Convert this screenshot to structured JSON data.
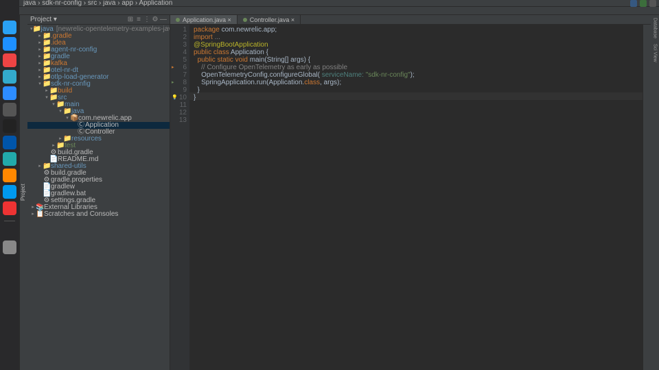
{
  "dock": [
    "finder",
    "safari",
    "chrome",
    "mail",
    "zoom",
    "settings",
    "terminal",
    "code",
    "vscode",
    "idea",
    "docker",
    "intellij"
  ],
  "menubar": [
    "java",
    "sdk-nr-config",
    "src",
    "java",
    "app",
    "Application"
  ],
  "proj_tool_label": "Project",
  "proj_header": {
    "title": "Project ▾",
    "icons": [
      "⊞",
      "≡",
      "⋮",
      "⚙",
      "—"
    ]
  },
  "tree": [
    {
      "d": 0,
      "a": "▾",
      "i": "📁",
      "t": "java",
      "g": "[newrelic-opentelemetry-examples-java]",
      "c": "dir-blue"
    },
    {
      "d": 1,
      "a": "▸",
      "i": "📁",
      "t": ".gradle",
      "c": "dir-orange"
    },
    {
      "d": 1,
      "a": "▸",
      "i": "📁",
      "t": ".idea",
      "c": "dir-orange"
    },
    {
      "d": 1,
      "a": "▸",
      "i": "📁",
      "t": "agent-nr-config",
      "c": "dir-blue"
    },
    {
      "d": 1,
      "a": "▸",
      "i": "📁",
      "t": "gradle",
      "c": "dir-blue"
    },
    {
      "d": 1,
      "a": "▸",
      "i": "📁",
      "t": "kafka",
      "c": "dir-orange"
    },
    {
      "d": 1,
      "a": "▸",
      "i": "📁",
      "t": "otel-nr-dt",
      "c": "dir-blue"
    },
    {
      "d": 1,
      "a": "▸",
      "i": "📁",
      "t": "otlp-load-generator",
      "c": "dir-blue"
    },
    {
      "d": 1,
      "a": "▾",
      "i": "📁",
      "t": "sdk-nr-config",
      "c": "dir-blue"
    },
    {
      "d": 2,
      "a": "▸",
      "i": "📁",
      "t": "build",
      "c": "dir-orange"
    },
    {
      "d": 2,
      "a": "▾",
      "i": "📁",
      "t": "src",
      "c": "dir-blue"
    },
    {
      "d": 3,
      "a": "▾",
      "i": "📁",
      "t": "main",
      "c": "dir-blue"
    },
    {
      "d": 4,
      "a": "▾",
      "i": "📁",
      "t": "java",
      "c": "dir-blue"
    },
    {
      "d": 5,
      "a": "▾",
      "i": "📦",
      "t": "com.newrelic.app",
      "c": "file-txt"
    },
    {
      "d": 6,
      "a": "",
      "i": "Ⓒ",
      "t": "Application",
      "c": "file-txt",
      "sel": true
    },
    {
      "d": 6,
      "a": "",
      "i": "Ⓒ",
      "t": "Controller",
      "c": "file-txt"
    },
    {
      "d": 4,
      "a": "▸",
      "i": "📁",
      "t": "resources",
      "c": "dir-blue"
    },
    {
      "d": 3,
      "a": "▸",
      "i": "📁",
      "t": "test",
      "c": "dir-green"
    },
    {
      "d": 2,
      "a": "",
      "i": "⚙",
      "t": "build.gradle",
      "c": "file-txt"
    },
    {
      "d": 2,
      "a": "",
      "i": "📄",
      "t": "README.md",
      "c": "file-txt"
    },
    {
      "d": 1,
      "a": "▸",
      "i": "📁",
      "t": "shared-utils",
      "c": "dir-blue"
    },
    {
      "d": 1,
      "a": "",
      "i": "⚙",
      "t": "build.gradle",
      "c": "file-txt"
    },
    {
      "d": 1,
      "a": "",
      "i": "⚙",
      "t": "gradle.properties",
      "c": "file-txt"
    },
    {
      "d": 1,
      "a": "",
      "i": "📄",
      "t": "gradlew",
      "c": "file-txt"
    },
    {
      "d": 1,
      "a": "",
      "i": "📄",
      "t": "gradlew.bat",
      "c": "file-txt"
    },
    {
      "d": 1,
      "a": "",
      "i": "⚙",
      "t": "settings.gradle",
      "c": "file-txt"
    },
    {
      "d": 0,
      "a": "▸",
      "i": "📚",
      "t": "External Libraries",
      "c": "file-txt"
    },
    {
      "d": 0,
      "a": "▸",
      "i": "📋",
      "t": "Scratches and Consoles",
      "c": "file-txt"
    }
  ],
  "tabs": [
    {
      "label": "Application.java",
      "active": true
    },
    {
      "label": "Controller.java",
      "active": false
    }
  ],
  "code_lines": [
    {
      "n": 1,
      "html": "<span class='kw'>package</span> com.newrelic.app;"
    },
    {
      "n": 2,
      "html": ""
    },
    {
      "n": 3,
      "html": "<span class='kw'>import</span> <span class='cmt'>...</span>"
    },
    {
      "n": 4,
      "html": ""
    },
    {
      "n": 5,
      "html": "<span class='ann'>@SpringBootApplication</span>"
    },
    {
      "n": 6,
      "html": "<span class='kw'>public class</span> Application {",
      "mark": "▸"
    },
    {
      "n": 7,
      "html": ""
    },
    {
      "n": 8,
      "html": "  <span class='kw'>public static void</span> main(String[] args) {",
      "mark": "▸",
      "mc": "#6a8759"
    },
    {
      "n": 9,
      "html": "    <span class='cmt'>// Configure OpenTelemetry as early as possible</span>"
    },
    {
      "n": 10,
      "html": "    OpenTelemetryConfig.configureGlobal( <span class='param'>serviceName:</span> <span class='str'>\"sdk-nr-config\"</span>);",
      "mark": "💡",
      "hl": true
    },
    {
      "n": 11,
      "html": "    SpringApplication.run(Application.<span class='kw'>class</span>, args);"
    },
    {
      "n": 12,
      "html": "  }"
    },
    {
      "n": 13,
      "html": "}"
    }
  ],
  "right_labels": [
    "Database",
    "Sci View"
  ]
}
